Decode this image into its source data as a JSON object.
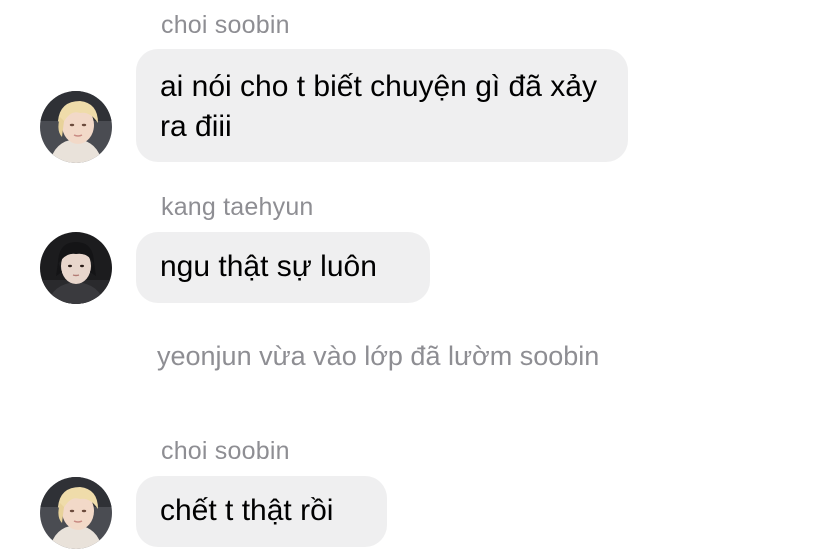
{
  "messages": [
    {
      "sender": "choi soobin",
      "avatar": "blonde-portrait-avatar",
      "text": "ai nói cho t biết chuyện gì đã xảy ra điii"
    },
    {
      "sender": "kang taehyun",
      "avatar": "dark-haired-portrait-avatar",
      "text": "ngu thật sự luôn"
    },
    {
      "system_text": "yeonjun vừa vào lớp đã lườm soobin"
    },
    {
      "sender": "choi soobin",
      "avatar": "blonde-portrait-avatar",
      "text": "chết t thật rồi"
    }
  ],
  "colors": {
    "bubble": "#efeff0",
    "secondary_text": "#8e8e93",
    "message_text": "#000000"
  }
}
